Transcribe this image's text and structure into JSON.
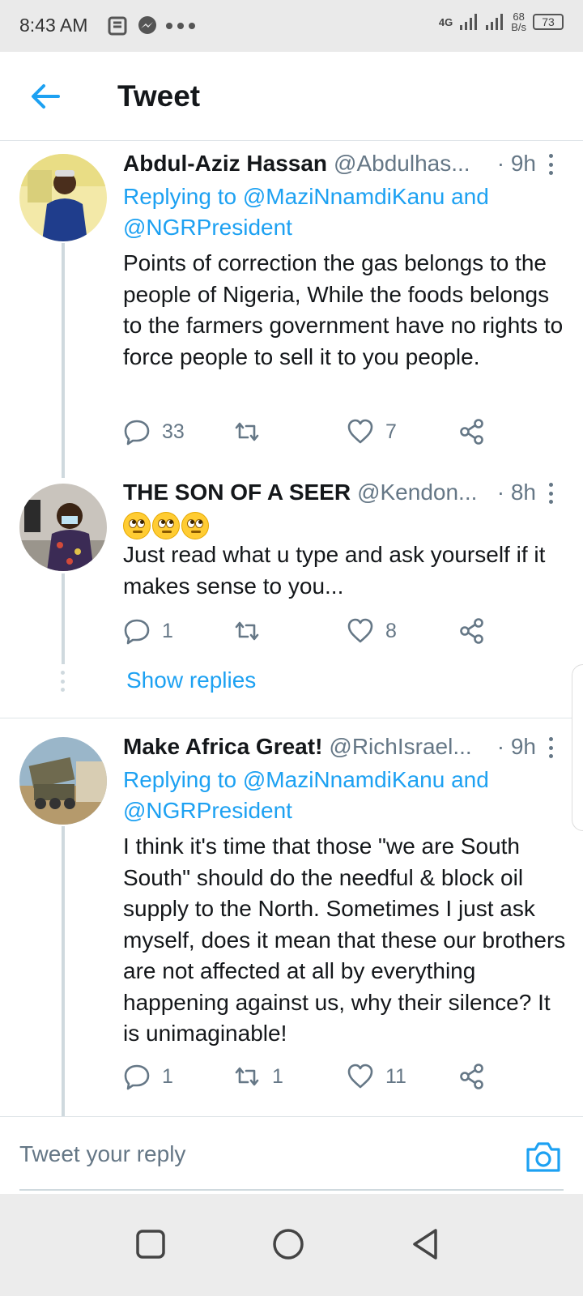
{
  "status_bar": {
    "time": "8:43 AM",
    "network": "4G",
    "speed_value": "68",
    "speed_unit": "B/s",
    "battery": "73"
  },
  "header": {
    "title": "Tweet"
  },
  "tweets": [
    {
      "name": "Abdul-Aziz Hassan",
      "handle": "@Abdulhas...",
      "time": "· 9h",
      "replying_label": "Replying to",
      "replying_to_1": "@MaziNnamdiKanu",
      "replying_and": "and",
      "replying_to_2": "@NGRPresident",
      "body": "Points of correction the gas belongs to the people of Nigeria, While the foods belongs to the farmers government have no rights to force people to sell it to you people.",
      "reply_count": "33",
      "retweet_count": "",
      "like_count": "7"
    },
    {
      "name": "THE SON OF A SEER",
      "handle": "@Kendon...",
      "time": "· 8h",
      "emojis": [
        "face-with-rolling-eyes",
        "face-with-rolling-eyes",
        "face-with-rolling-eyes"
      ],
      "body": "Just read what u type and ask yourself if it makes sense to you...",
      "reply_count": "1",
      "retweet_count": "",
      "like_count": "8",
      "show_replies": "Show replies"
    },
    {
      "name": "Make Africa Great!",
      "handle": "@RichIsrael...",
      "time": "· 9h",
      "replying_label": "Replying to",
      "replying_to_1": "@MaziNnamdiKanu",
      "replying_and": "and",
      "replying_to_2": "@NGRPresident",
      "body": "I think it's time that those \"we are South South\" should do the needful & block oil supply to the North. Sometimes I just ask myself, does it mean that these our brothers are not affected at all by everything happening against us, why their silence? It is unimaginable!",
      "reply_count": "1",
      "retweet_count": "1",
      "like_count": "11"
    }
  ],
  "reply_bar": {
    "placeholder": "Tweet your reply"
  },
  "colors": {
    "accent": "#1da1f2",
    "text": "#14171a",
    "muted": "#657786"
  }
}
